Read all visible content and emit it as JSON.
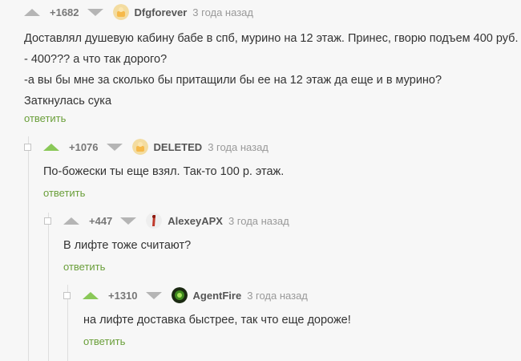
{
  "comments": [
    {
      "score": "+1682",
      "user": "Dfgforever",
      "time": "3 года назад",
      "lines": [
        "Доставлял душевую кабину бабе в спб, мурино на 12 этаж. Принес, гворю подъем 400 руб.",
        "- 400??? а что так дорого?",
        "-а вы бы мне за сколько бы притащили бы ее на 12 этаж да еще и в мурино?",
        "Заткнулась сука"
      ],
      "reply": "ответить",
      "upvote_color": "#b5b5b5"
    },
    {
      "score": "+1076",
      "user": "DELETED",
      "time": "3 года назад",
      "lines": [
        "По-божески ты еще взял. Так-то 100 р. этаж."
      ],
      "reply": "ответить",
      "upvote_color": "#8ac858"
    },
    {
      "score": "+447",
      "user": "AlexeyAPX",
      "time": "3 года назад",
      "lines": [
        "В лифте тоже считают?"
      ],
      "reply": "ответить",
      "upvote_color": "#b5b5b5"
    },
    {
      "score": "+1310",
      "user": "AgentFire",
      "time": "3 года назад",
      "lines": [
        "на лифте доставка быстрее, так что еще дороже!"
      ],
      "reply": "ответить",
      "upvote_color": "#8ac858"
    }
  ],
  "colors": {
    "accent": "#6a9f3a",
    "upvote_active": "#8ac858"
  }
}
